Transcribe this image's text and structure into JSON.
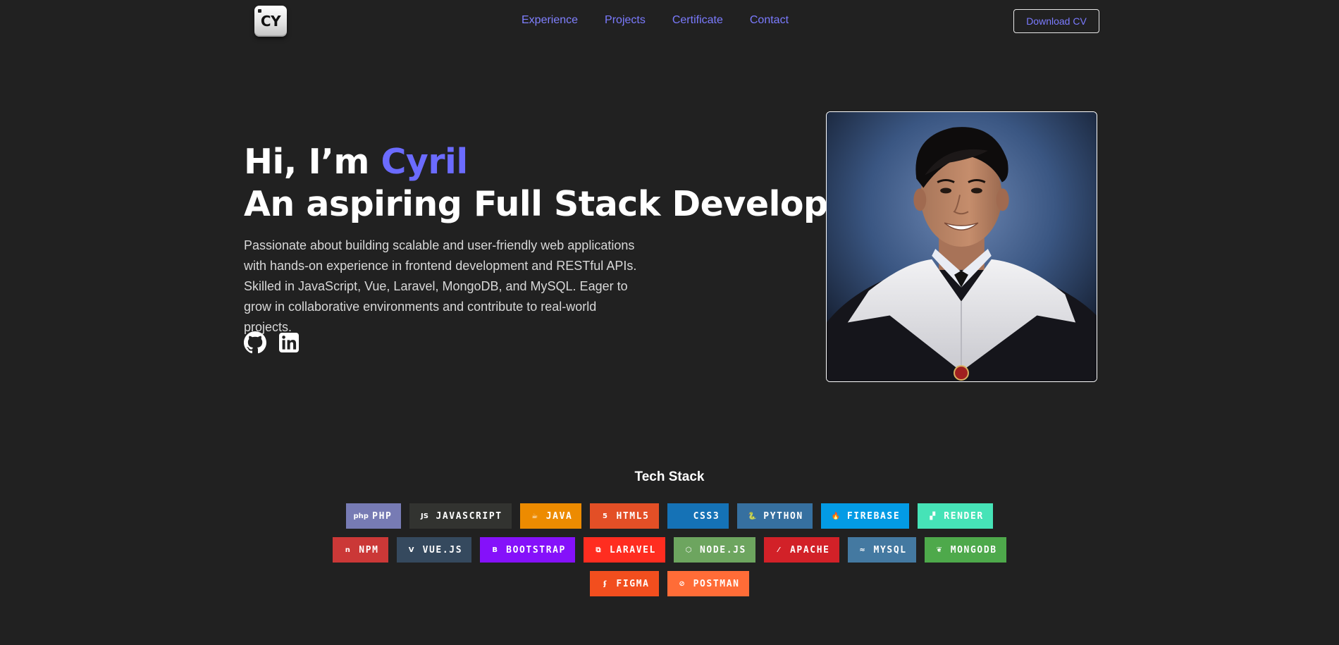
{
  "nav": {
    "logo_text": "CY",
    "links": [
      "Experience",
      "Projects",
      "Certificate",
      "Contact"
    ],
    "download_label": "Download CV"
  },
  "hero": {
    "greeting": "Hi, I’m ",
    "name": "Cyril",
    "role": "An aspiring Full Stack Developer",
    "description": "Passionate about building scalable and user-friendly web applications with hands-on experience in frontend development and RESTful APIs. Skilled in JavaScript, Vue, Laravel, MongoDB, and MySQL. Eager to grow in collaborative environments and contribute to real-world projects.",
    "socials": [
      "github-icon",
      "linkedin-icon"
    ]
  },
  "tech": {
    "title": "Tech Stack",
    "rows": [
      [
        {
          "label": "PHP",
          "color": "#777bb4",
          "icon": "php-icon",
          "glyph": "php"
        },
        {
          "label": "JAVASCRIPT",
          "color": "#323330",
          "icon": "javascript-icon",
          "glyph": "JS"
        },
        {
          "label": "JAVA",
          "color": "#ed8b00",
          "icon": "java-icon",
          "glyph": "☕"
        },
        {
          "label": "HTML5",
          "color": "#e34f26",
          "icon": "html5-icon",
          "glyph": "5"
        },
        {
          "label": "CSS3",
          "color": "#1572b6",
          "icon": "css3-icon",
          "glyph": ""
        },
        {
          "label": "PYTHON",
          "color": "#3670a0",
          "icon": "python-icon",
          "glyph": "🐍"
        },
        {
          "label": "FIREBASE",
          "color": "#039be5",
          "icon": "firebase-icon",
          "glyph": "🔥"
        },
        {
          "label": "RENDER",
          "color": "#46e3b7",
          "icon": "render-icon",
          "glyph": "▞"
        }
      ],
      [
        {
          "label": "NPM",
          "color": "#cb3837",
          "icon": "npm-icon",
          "glyph": "n"
        },
        {
          "label": "VUE.JS",
          "color": "#35495e",
          "icon": "vue-icon",
          "glyph": "V"
        },
        {
          "label": "BOOTSTRAP",
          "color": "#8511fa",
          "icon": "bootstrap-icon",
          "glyph": "B"
        },
        {
          "label": "LARAVEL",
          "color": "#ff2d20",
          "icon": "laravel-icon",
          "glyph": "⧉"
        },
        {
          "label": "NODE.JS",
          "color": "#6da55f",
          "icon": "nodejs-icon",
          "glyph": "⬡"
        },
        {
          "label": "APACHE",
          "color": "#d22128",
          "icon": "apache-icon",
          "glyph": "⁄"
        },
        {
          "label": "MYSQL",
          "color": "#4479a1",
          "icon": "mysql-icon",
          "glyph": "≈"
        },
        {
          "label": "MONGODB",
          "color": "#4ea94b",
          "icon": "mongodb-icon",
          "glyph": "❦"
        }
      ],
      [
        {
          "label": "FIGMA",
          "color": "#f24e1e",
          "icon": "figma-icon",
          "glyph": "ʄ"
        },
        {
          "label": "POSTMAN",
          "color": "#ff6c37",
          "icon": "postman-icon",
          "glyph": "⊘"
        }
      ]
    ]
  }
}
